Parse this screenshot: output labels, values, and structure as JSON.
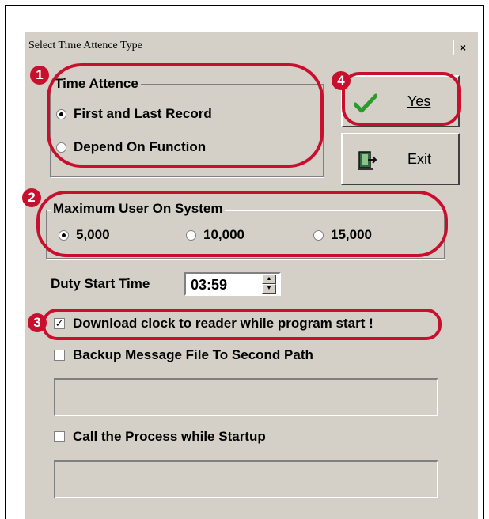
{
  "window": {
    "title": "Select Time Attence Type",
    "close_glyph": "×"
  },
  "time_attence": {
    "legend": "Time Attence",
    "options": [
      {
        "label": "First and Last Record",
        "selected": true
      },
      {
        "label": "Depend On Function",
        "selected": false
      }
    ]
  },
  "buttons": {
    "yes": {
      "underline_char": "Y",
      "rest": "es",
      "icon": "green-check-icon"
    },
    "exit": {
      "underline_char": "E",
      "rest": "xit",
      "icon": "exit-door-icon"
    }
  },
  "max_users": {
    "legend": "Maximum User On System",
    "options": [
      {
        "label": "5,000",
        "selected": true
      },
      {
        "label": "10,000",
        "selected": false
      },
      {
        "label": "15,000",
        "selected": false
      }
    ]
  },
  "duty_start": {
    "label": "Duty Start Time",
    "value": "03:59"
  },
  "checkboxes": {
    "download_clock": {
      "label": "Download clock to reader while program start !",
      "checked": true
    },
    "backup_message": {
      "label": "Backup Message File To Second Path",
      "checked": false,
      "path_value": ""
    },
    "call_process": {
      "label": "Call the Process while Startup",
      "checked": false,
      "path_value": ""
    }
  },
  "annotations": {
    "badges": [
      "1",
      "2",
      "3",
      "4"
    ],
    "color": "#c8102e"
  },
  "colors": {
    "dialog_face": "#d4d0c8",
    "annotation_red": "#c8102e",
    "check_green": "#2e9a2e"
  }
}
